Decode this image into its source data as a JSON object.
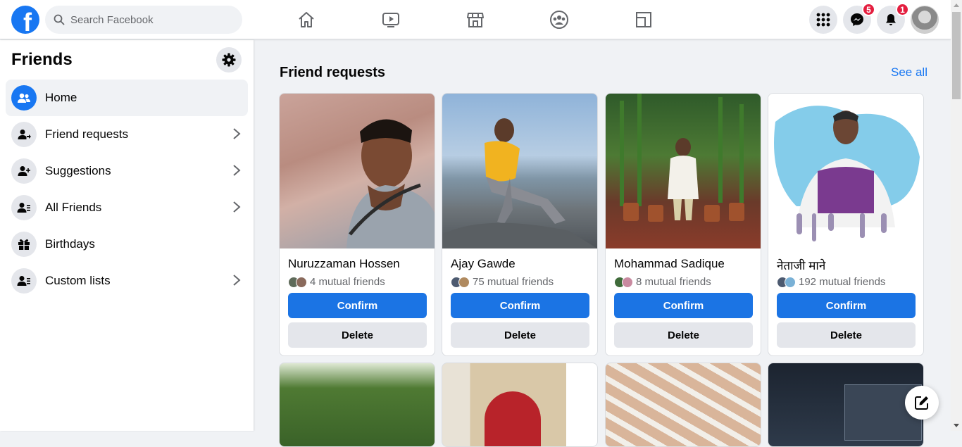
{
  "app": {
    "brand_letter": "f",
    "brand_color": "#1877f2"
  },
  "search": {
    "placeholder": "Search Facebook",
    "value": ""
  },
  "nav": {
    "icons": [
      "home-icon",
      "watch-icon",
      "marketplace-icon",
      "groups-icon",
      "gaming-icon"
    ]
  },
  "header_right": {
    "menu_icon": "grid-menu-icon",
    "messenger_badge": "5",
    "notifications_badge": "1"
  },
  "sidebar": {
    "title": "Friends",
    "items": [
      {
        "label": "Home",
        "icon": "friends-icon",
        "active": true,
        "chevron": false
      },
      {
        "label": "Friend requests",
        "icon": "friend-request-icon",
        "active": false,
        "chevron": true
      },
      {
        "label": "Suggestions",
        "icon": "add-friend-icon",
        "active": false,
        "chevron": true
      },
      {
        "label": "All Friends",
        "icon": "friends-list-icon",
        "active": false,
        "chevron": true
      },
      {
        "label": "Birthdays",
        "icon": "gift-icon",
        "active": false,
        "chevron": false
      },
      {
        "label": "Custom lists",
        "icon": "custom-list-icon",
        "active": false,
        "chevron": true
      }
    ]
  },
  "main": {
    "section_title": "Friend requests",
    "see_all": "See all",
    "requests": [
      {
        "name": "Nuruzzaman Hossen",
        "mutual": "4 mutual friends",
        "confirm": "Confirm",
        "delete": "Delete"
      },
      {
        "name": "Ajay Gawde",
        "mutual": "75 mutual friends",
        "confirm": "Confirm",
        "delete": "Delete"
      },
      {
        "name": "Mohammad Sadique",
        "mutual": "8 mutual friends",
        "confirm": "Confirm",
        "delete": "Delete"
      },
      {
        "name": "नेताजी माने",
        "mutual": "192 mutual friends",
        "confirm": "Confirm",
        "delete": "Delete"
      }
    ]
  },
  "colors": {
    "accent": "#1877f2",
    "confirm_bg": "#1b74e4",
    "badge": "#e41e3f",
    "link": "#1877f2"
  }
}
